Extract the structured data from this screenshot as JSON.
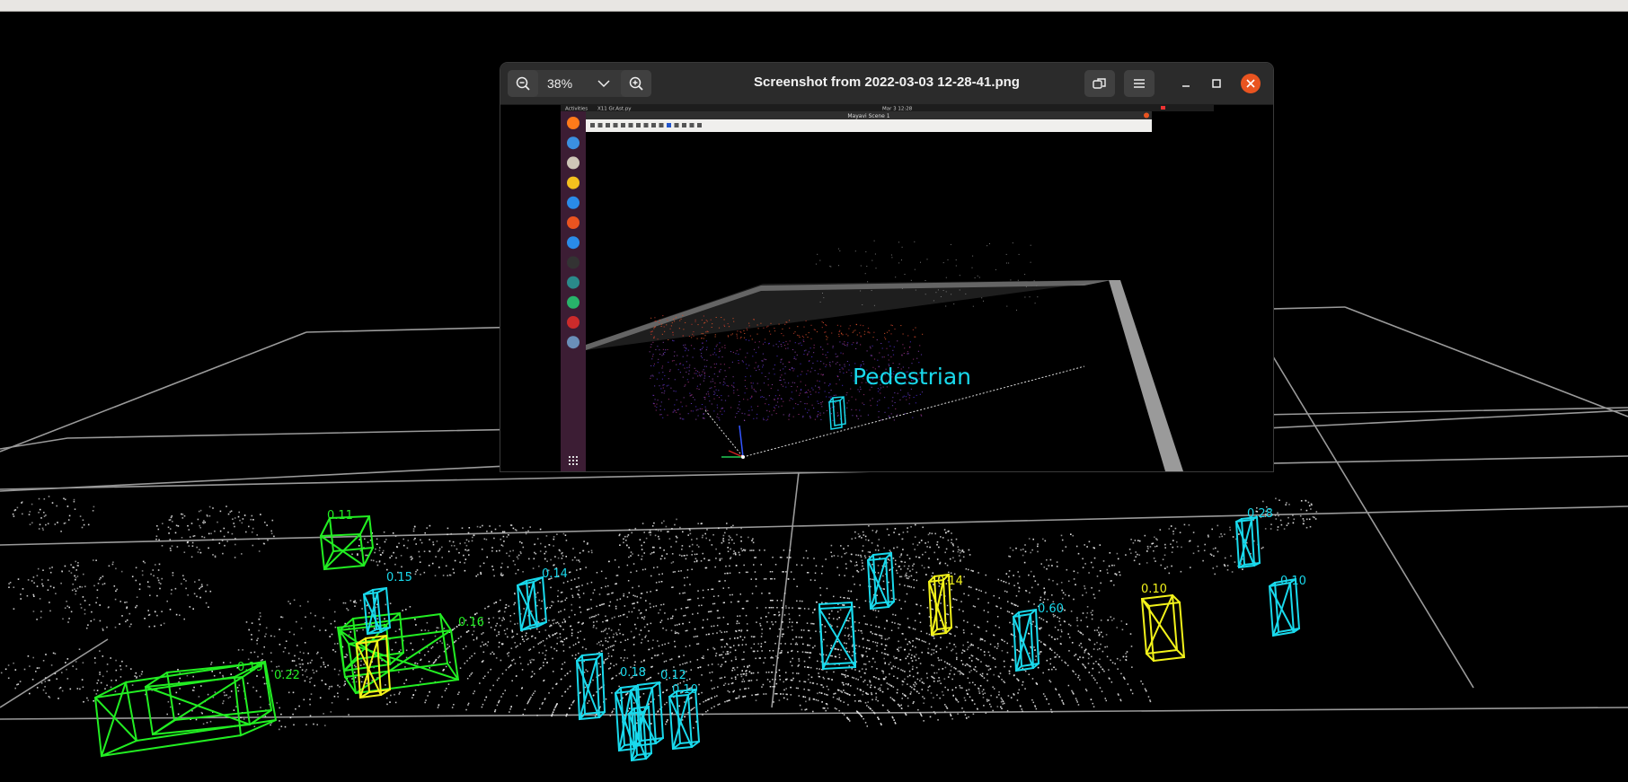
{
  "viewer": {
    "title": "Screenshot from 2022-03-03 12-28-41.png",
    "zoom": "38%",
    "inner": {
      "topbar_left": "Activities",
      "topbar_app": "X11 Gr.Ast.py",
      "topbar_clock": "Mar 3  12:28",
      "window_title": "Mayavi Scene 1",
      "label": "Pedestrian",
      "dock_icons": [
        "firefox-icon",
        "thunderbird-icon",
        "files-icon",
        "rhythmbox-icon",
        "writer-icon",
        "software-icon",
        "help-icon",
        "terminal-icon",
        "settings-icon",
        "sync-icon",
        "app-icon",
        "image-viewer-icon"
      ]
    }
  },
  "scene": {
    "boxes": [
      {
        "label": "0.11",
        "color": "green"
      },
      {
        "label": "0.22",
        "color": "green"
      },
      {
        "label": "0.19",
        "color": "green"
      },
      {
        "label": "0.16",
        "color": "green"
      },
      {
        "label": "0.15",
        "color": "cyan"
      },
      {
        "label": "0.14",
        "color": "cyan"
      },
      {
        "label": "0.18",
        "color": "cyan"
      },
      {
        "label": "0.12",
        "color": "cyan"
      },
      {
        "label": "0.10",
        "color": "cyan"
      },
      {
        "label": "0.60",
        "color": "cyan"
      },
      {
        "label": "0.28",
        "color": "cyan"
      },
      {
        "label": "0.10",
        "color": "cyan"
      },
      {
        "label": "0.10",
        "color": "yellow"
      },
      {
        "label": "0.14",
        "color": "yellow"
      }
    ]
  },
  "colors": {
    "green": "#22ee22",
    "cyan": "#19d9ec",
    "yellow": "#f2f21a",
    "bg": "#000000"
  }
}
